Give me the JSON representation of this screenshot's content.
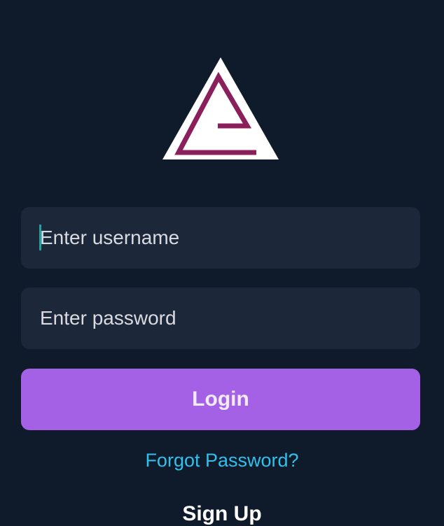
{
  "logo": {
    "name": "app-logo",
    "background_color": "#ffffff",
    "mark_color": "#8b1f5b"
  },
  "login_form": {
    "username_placeholder": "Enter username",
    "username_value": "",
    "password_placeholder": "Enter password",
    "password_value": "",
    "login_label": "Login",
    "forgot_password_label": "Forgot Password?",
    "sign_up_label": "Sign Up"
  },
  "colors": {
    "background": "#0f1a2a",
    "field_background": "#1c273a",
    "primary_button": "#a461e6",
    "link": "#2fc1ee",
    "caret": "#1fa39a"
  }
}
